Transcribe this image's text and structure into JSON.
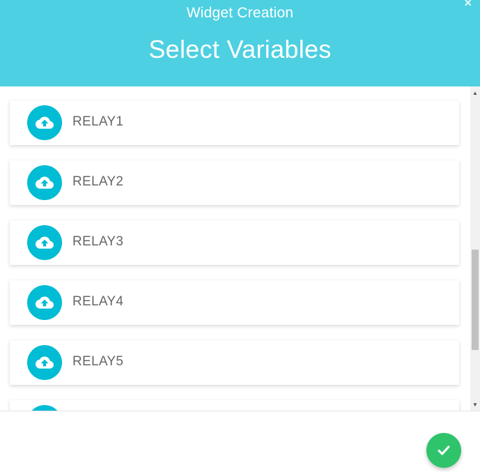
{
  "header": {
    "subtitle": "Widget Creation",
    "title": "Select Variables",
    "close_symbol": "×",
    "background_color": "#4dd0e1"
  },
  "variables": [
    {
      "label": "RELAY1",
      "icon": "cloud-upload-icon"
    },
    {
      "label": "RELAY2",
      "icon": "cloud-upload-icon"
    },
    {
      "label": "RELAY3",
      "icon": "cloud-upload-icon"
    },
    {
      "label": "RELAY4",
      "icon": "cloud-upload-icon"
    },
    {
      "label": "RELAY5",
      "icon": "cloud-upload-icon"
    },
    {
      "label": "",
      "icon": "cloud-upload-icon"
    }
  ],
  "footer": {
    "confirm_icon": "checkmark-icon",
    "confirm_color": "#2fc36b"
  },
  "scrollbar": {
    "up_symbol": "▲",
    "down_symbol": "▼"
  },
  "accent_color": "#00bcd4"
}
